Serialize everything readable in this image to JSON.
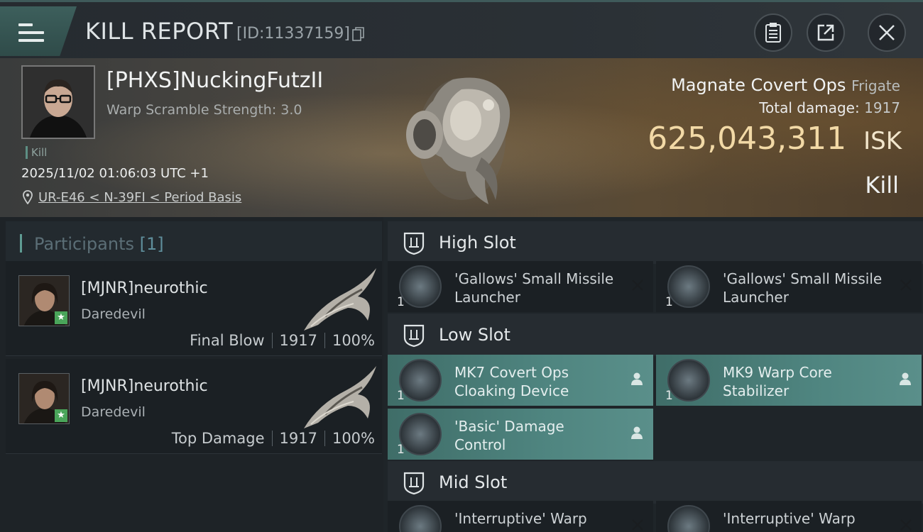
{
  "header": {
    "title": "KILL REPORT",
    "report_id": "[ID:11337159]"
  },
  "victim": {
    "name": "[PHXS]NuckingFutzII",
    "warp_scramble": "Warp Scramble Strength: 3.0",
    "tag": "Kill",
    "datetime": "2025/11/02 01:06:03 UTC +1",
    "location": "UR-E46 < N-39FI < Period Basis",
    "ship_type": "Magnate Covert Ops",
    "ship_class": "Frigate",
    "total_damage_label": "Total damage:",
    "total_damage": "1917",
    "isk_value": "625,043,311",
    "isk_unit": "ISK",
    "result": "Kill"
  },
  "participants": {
    "title": "Participants",
    "count": "[1]",
    "list": [
      {
        "name": "[MJNR]neurothic",
        "ship": "Daredevil",
        "role": "Final Blow",
        "damage": "1917",
        "percent": "100%"
      },
      {
        "name": "[MJNR]neurothic",
        "ship": "Daredevil",
        "role": "Top Damage",
        "damage": "1917",
        "percent": "100%"
      }
    ]
  },
  "fitting": {
    "high_slot": {
      "label": "High Slot",
      "modules": [
        {
          "name": "'Gallows' Small Missile Launcher",
          "qty": "1"
        },
        {
          "name": "'Gallows' Small Missile Launcher",
          "qty": "1"
        }
      ]
    },
    "low_slot": {
      "label": "Low Slot",
      "modules": [
        {
          "name": "MK7 Covert Ops Cloaking Device",
          "qty": "1"
        },
        {
          "name": "MK9 Warp Core Stabilizer",
          "qty": "1"
        },
        {
          "name": "'Basic' Damage Control",
          "qty": "1"
        }
      ]
    },
    "mid_slot": {
      "label": "Mid Slot",
      "modules": [
        {
          "name": "'Interruptive' Warp",
          "qty": "1"
        },
        {
          "name": "'Interruptive' Warp",
          "qty": "1"
        }
      ]
    }
  },
  "icons": {
    "menu": "hamburger-icon",
    "copy": "copy-icon",
    "clipboard": "clipboard-icon",
    "share": "share-icon",
    "close": "close-icon",
    "location": "pin-icon",
    "slot": "slot-shield-icon",
    "remove": "x-icon",
    "pilot": "person-icon"
  },
  "colors": {
    "accent": "#5f9c93",
    "isk": "#f2d9a6",
    "active_module": "#4f8580"
  }
}
